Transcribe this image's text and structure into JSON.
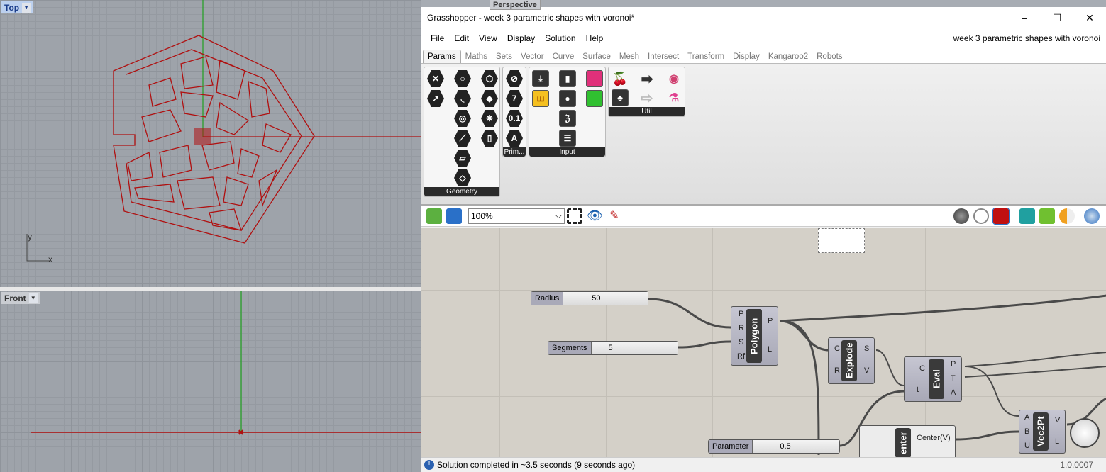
{
  "viewports": {
    "top": {
      "label": "Top",
      "axis_y": "y",
      "axis_x": "x"
    },
    "front": {
      "label": "Front"
    },
    "perspective": {
      "label": "Perspective"
    }
  },
  "window": {
    "title": "Grasshopper - week 3 parametric shapes with voronoi*",
    "minimize": "–",
    "maximize": "☐",
    "close": "✕"
  },
  "menu": {
    "items": [
      "File",
      "Edit",
      "View",
      "Display",
      "Solution",
      "Help"
    ],
    "document": "week 3 parametric shapes with voronoi"
  },
  "tabs": [
    "Params",
    "Maths",
    "Sets",
    "Vector",
    "Curve",
    "Surface",
    "Mesh",
    "Intersect",
    "Transform",
    "Display",
    "Kangaroo2",
    "Robots"
  ],
  "ribbon": {
    "panels": [
      "Geometry",
      "Prim...",
      "Input",
      "Util"
    ]
  },
  "toolbar": {
    "zoom": "100%"
  },
  "canvas": {
    "radius": {
      "label": "Radius",
      "value": "50"
    },
    "segments": {
      "label": "Segments",
      "value": "5"
    },
    "parameter": {
      "label": "Parameter",
      "value": "0.5"
    },
    "polygon": {
      "name": "Polygon",
      "inputs": [
        "P",
        "R",
        "S",
        "Rf"
      ],
      "outputs": [
        "P",
        "L"
      ]
    },
    "explode": {
      "name": "Explode",
      "inputs": [
        "C",
        "R"
      ],
      "outputs": [
        "S",
        "V"
      ]
    },
    "eval": {
      "name": "Eval",
      "inputs": [
        "C",
        "t"
      ],
      "outputs": [
        "P",
        "T",
        "A"
      ]
    },
    "center": {
      "name": "enter",
      "output": "Center(V)"
    },
    "vec2pt": {
      "name": "Vec2Pt",
      "inputs": [
        "A",
        "B",
        "U"
      ],
      "outputs": [
        "V",
        "L"
      ]
    }
  },
  "status": {
    "message": "Solution completed in ~3.5 seconds (9 seconds ago)",
    "version": "1.0.0007"
  },
  "colors": {
    "curve": "#b01010",
    "x_axis": "#b01010",
    "y_axis": "#20a020",
    "canvas": "#d4d0c8"
  }
}
